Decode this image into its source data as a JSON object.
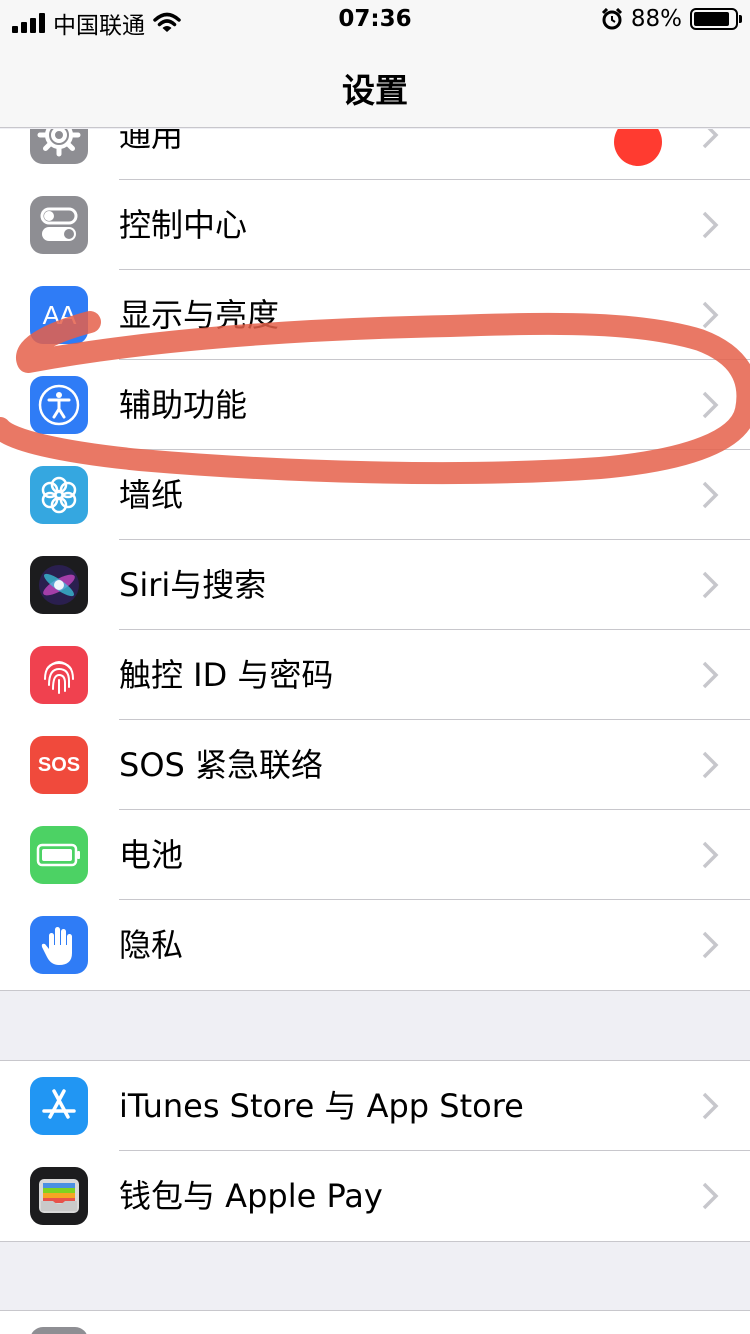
{
  "status_bar": {
    "carrier": "中国联通",
    "time": "07:36",
    "battery_percent": "88%",
    "battery_level": 0.88,
    "icons": [
      "signal-icon",
      "wifi-icon",
      "alarm-icon",
      "battery-icon"
    ]
  },
  "nav": {
    "title": "设置"
  },
  "groups": [
    {
      "items": [
        {
          "label": "通用",
          "icon": "gear-icon",
          "color": "#8e8e93",
          "badge": true
        },
        {
          "label": "控制中心",
          "icon": "control-center-icon",
          "color": "#8e8e93"
        },
        {
          "label": "显示与亮度",
          "icon": "display-brightness-icon",
          "color": "#2f7cf6",
          "icon_text": "AA"
        },
        {
          "label": "辅助功能",
          "icon": "accessibility-icon",
          "color": "#2f7cf6"
        },
        {
          "label": "墙纸",
          "icon": "wallpaper-flower-icon",
          "color": "#35a7e0"
        },
        {
          "label": "Siri与搜索",
          "icon": "siri-icon",
          "color": "#1c1c1e"
        },
        {
          "label": "触控 ID 与密码",
          "icon": "fingerprint-icon",
          "color": "#f0414f"
        },
        {
          "label": "SOS 紧急联络",
          "icon": "sos-icon",
          "color": "#f04a3c",
          "icon_text": "SOS"
        },
        {
          "label": "电池",
          "icon": "battery-settings-icon",
          "color": "#4cd264"
        },
        {
          "label": "隐私",
          "icon": "privacy-hand-icon",
          "color": "#2f7cf6"
        }
      ]
    },
    {
      "items": [
        {
          "label": "iTunes Store 与 App Store",
          "icon": "app-store-icon",
          "color": "#2196f3"
        },
        {
          "label": "钱包与 Apple Pay",
          "icon": "wallet-icon",
          "color": "#1c1c1e"
        }
      ]
    }
  ],
  "annotation": {
    "color": "#e5604a",
    "highlighted_item": "辅助功能"
  }
}
